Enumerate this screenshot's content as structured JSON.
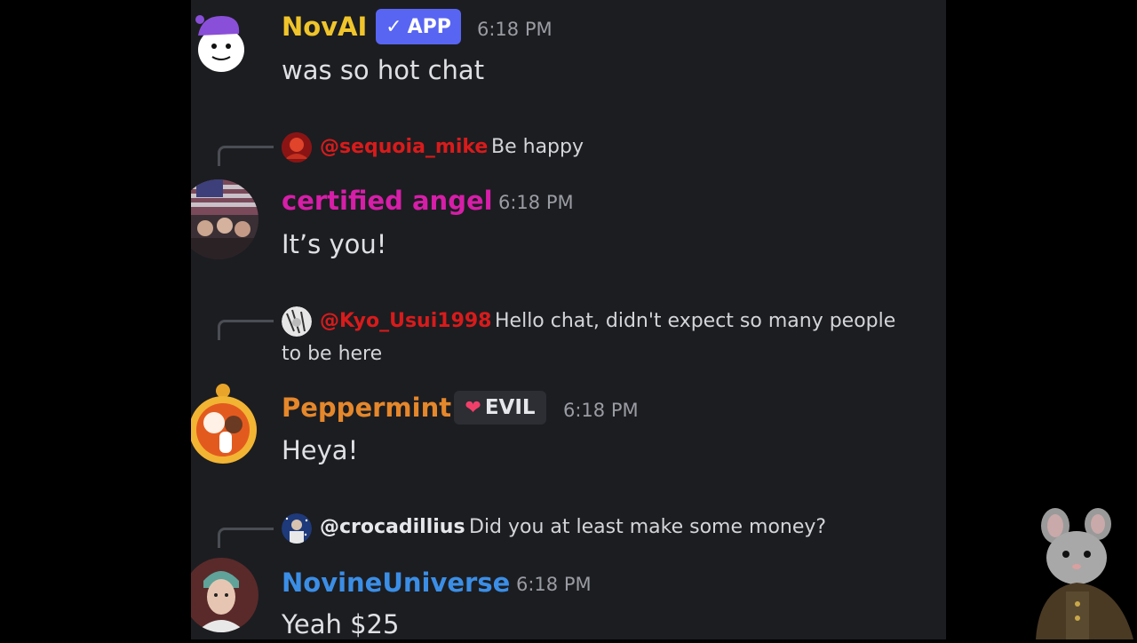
{
  "messages": [
    {
      "username": "NovAI",
      "username_color": "#f0c52b",
      "badge": "APP",
      "timestamp": "6:18 PM",
      "text": "was so hot chat"
    },
    {
      "reply_to": {
        "name": "@sequoia_mike",
        "name_color": "#d81b1b",
        "text": "Be happy"
      },
      "username": "certified angel",
      "username_color": "#d61ea8",
      "timestamp": "6:18 PM",
      "text": "It’s you!"
    },
    {
      "reply_to": {
        "name": "@Kyo_Usui1998",
        "name_color": "#d81b1b",
        "text": "Hello chat, didn't expect so many people to be here"
      },
      "username": "Peppermint",
      "username_color": "#e5872b",
      "badge": "EVIL",
      "timestamp": "6:18 PM",
      "text": "Heya!"
    },
    {
      "reply_to": {
        "name": "@crocadillius",
        "name_color": "#e6e7ea",
        "text": "Did you at least make some money?"
      },
      "username": "NovineUniverse",
      "username_color": "#3b8ee6",
      "timestamp": "6:18 PM",
      "text": "Yeah $25"
    }
  ]
}
